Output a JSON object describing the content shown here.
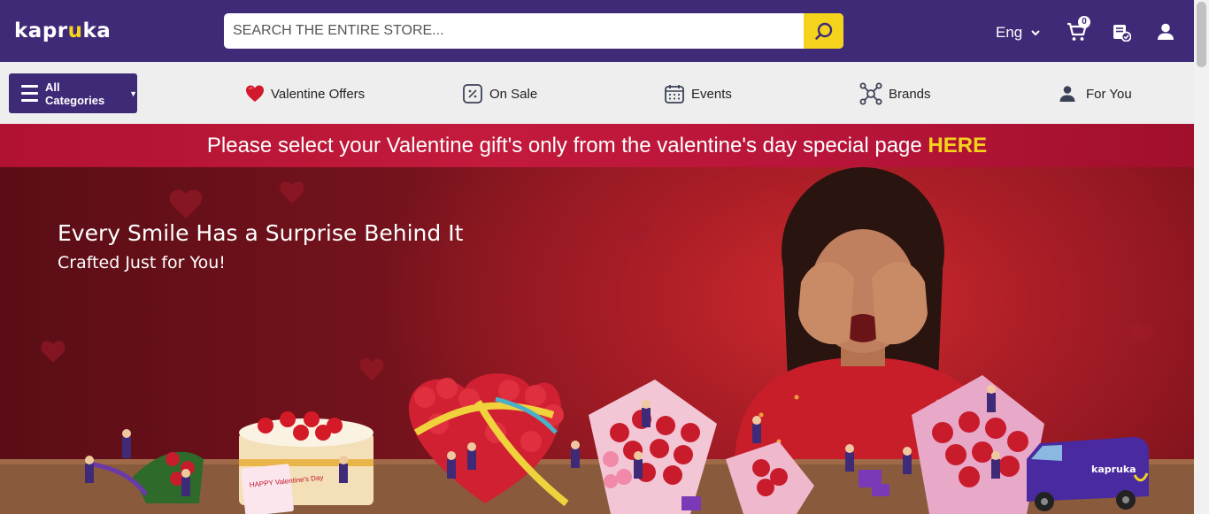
{
  "header": {
    "logo_text": "kapruka",
    "search_placeholder": "SEARCH THE ENTIRE STORE...",
    "language": "Eng",
    "cart_count": "0"
  },
  "nav": {
    "all_categories": "All Categories",
    "items": [
      {
        "label": "Valentine Offers",
        "icon": "heart-icon"
      },
      {
        "label": "On Sale",
        "icon": "discount-tag-icon"
      },
      {
        "label": "Events",
        "icon": "calendar-icon"
      },
      {
        "label": "Brands",
        "icon": "network-icon"
      },
      {
        "label": "For You",
        "icon": "person-icon"
      }
    ]
  },
  "announcement": {
    "text": "Please select your Valentine gift's only from the valentine's day special page ",
    "link": "HERE"
  },
  "hero": {
    "title": "Every Smile Has a Surprise Behind It",
    "subtitle": "Crafted Just for You!",
    "card_text": "HAPPY Valentine's Day",
    "van_logo": "kapruka"
  },
  "colors": {
    "brand_purple": "#3f2a78",
    "accent_yellow": "#f5d31c",
    "strip_red": "#b8143a"
  }
}
